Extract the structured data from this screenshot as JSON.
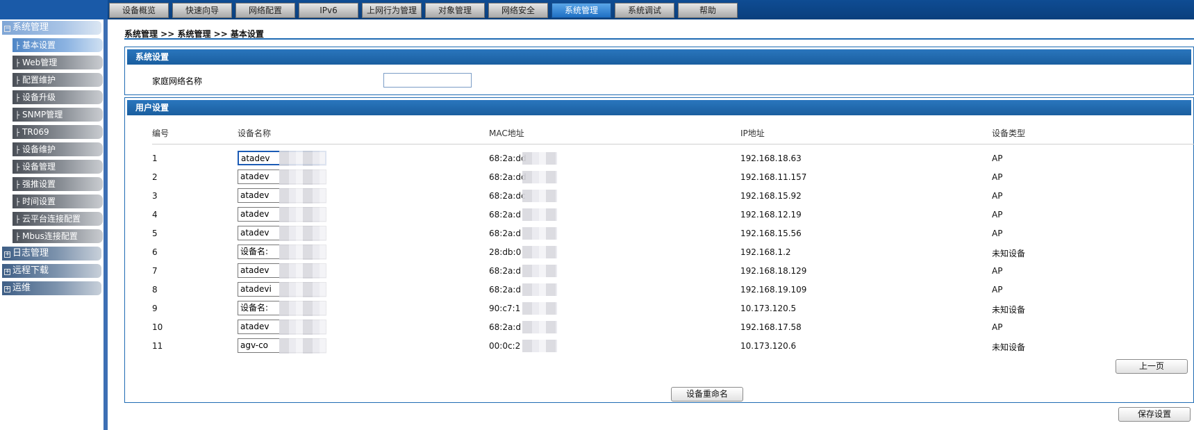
{
  "top_nav": {
    "tabs": [
      {
        "label": "设备概览"
      },
      {
        "label": "快速向导"
      },
      {
        "label": "网络配置"
      },
      {
        "label": "IPv6"
      },
      {
        "label": "上网行为管理"
      },
      {
        "label": "对象管理"
      },
      {
        "label": "网络安全"
      },
      {
        "label": "系统管理"
      },
      {
        "label": "系统调试"
      },
      {
        "label": "帮助"
      }
    ],
    "active_tab": "系统管理"
  },
  "sidebar": {
    "group_system": {
      "label": "系统管理",
      "expanded": true
    },
    "items": [
      {
        "label": "基本设置"
      },
      {
        "label": "Web管理"
      },
      {
        "label": "配置维护"
      },
      {
        "label": "设备升级"
      },
      {
        "label": "SNMP管理"
      },
      {
        "label": "TR069"
      },
      {
        "label": "设备维护"
      },
      {
        "label": "设备管理"
      },
      {
        "label": "强推设置"
      },
      {
        "label": "时间设置"
      },
      {
        "label": "云平台连接配置"
      },
      {
        "label": "Mbus连接配置"
      }
    ],
    "group_log": {
      "label": "日志管理"
    },
    "group_remote": {
      "label": "远程下载"
    },
    "group_ops": {
      "label": "运维"
    }
  },
  "breadcrumb": "系统管理 >> 系统管理 >> 基本设置",
  "system_settings": {
    "title": "系统设置",
    "home_network_label": "家庭网络名称",
    "home_network_value": ""
  },
  "user_settings": {
    "title": "用户设置",
    "columns": [
      "编号",
      "设备名称",
      "MAC地址",
      "IP地址",
      "设备类型"
    ],
    "rows": [
      {
        "no": "1",
        "name": "atadev",
        "mac": "68:2a:dd",
        "ip": "192.168.18.63",
        "type": "AP"
      },
      {
        "no": "2",
        "name": "atadev",
        "mac": "68:2a:dd",
        "ip": "192.168.11.157",
        "type": "AP"
      },
      {
        "no": "3",
        "name": "atadev",
        "mac": "68:2a:dc",
        "ip": "192.168.15.92",
        "type": "AP"
      },
      {
        "no": "4",
        "name": "atadev",
        "mac": "68:2a:d",
        "ip": "192.168.12.19",
        "type": "AP"
      },
      {
        "no": "5",
        "name": "atadev",
        "mac": "68:2a:d",
        "ip": "192.168.15.56",
        "type": "AP"
      },
      {
        "no": "6",
        "name": "设备名:",
        "mac": "28:db:0",
        "ip": "192.168.1.2",
        "type": "未知设备"
      },
      {
        "no": "7",
        "name": "atadev",
        "mac": "68:2a:d",
        "ip": "192.168.18.129",
        "type": "AP"
      },
      {
        "no": "8",
        "name": "atadevi",
        "mac": "68:2a:d",
        "ip": "192.168.19.109",
        "type": "AP"
      },
      {
        "no": "9",
        "name": "设备名:",
        "mac": "90:c7:1",
        "ip": "10.173.120.5",
        "type": "未知设备"
      },
      {
        "no": "10",
        "name": "atadev",
        "mac": "68:2a:d",
        "ip": "192.168.17.58",
        "type": "AP"
      },
      {
        "no": "11",
        "name": "agv-co",
        "mac": "00:0c:2",
        "ip": "10.173.120.6",
        "type": "未知设备"
      }
    ],
    "prev_page_label": "上一页",
    "rename_label": "设备重命名"
  },
  "save_label": "保存设置"
}
